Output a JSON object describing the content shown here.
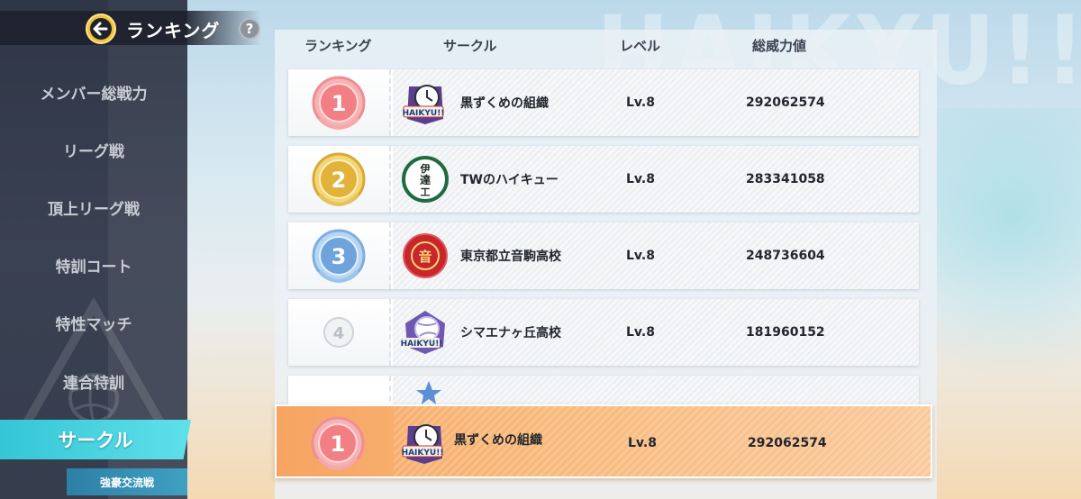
{
  "header": {
    "title": "ランキング",
    "help_label": "?"
  },
  "background": {
    "watermark": "HAIKYU!!"
  },
  "sidebar": {
    "items": [
      {
        "label": "メンバー総戦力"
      },
      {
        "label": "リーグ戦"
      },
      {
        "label": "頂上リーグ戦"
      },
      {
        "label": "特訓コート"
      },
      {
        "label": "特性マッチ"
      },
      {
        "label": "連合特訓"
      }
    ],
    "active": {
      "label": "サークル"
    },
    "sub": {
      "label": "強豪交流戦"
    }
  },
  "table": {
    "columns": [
      "ランキング",
      "サークル",
      "レベル",
      "総威力値"
    ],
    "rows": [
      {
        "rank": "1",
        "name": "黒ずくめの組織",
        "level": "Lv.8",
        "power": "292062574",
        "medal": "pink",
        "emblem": "haikyu-clock"
      },
      {
        "rank": "2",
        "name": "TWのハイキュー",
        "level": "Lv.8",
        "power": "283341058",
        "medal": "gold",
        "emblem": "date-kogyo"
      },
      {
        "rank": "3",
        "name": "東京都立音駒高校",
        "level": "Lv.8",
        "power": "248736604",
        "medal": "blue",
        "emblem": "nekoma"
      },
      {
        "rank": "4",
        "name": "シマエナヶ丘高校",
        "level": "Lv.8",
        "power": "181960152",
        "medal": "plain",
        "emblem": "haikyu-ball"
      }
    ],
    "self_row": {
      "rank": "1",
      "name": "黒ずくめの組織",
      "level": "Lv.8",
      "power": "292062574",
      "emblem_text": "HAIKYU!!"
    }
  },
  "emblem_text": {
    "haikyu": "HAIKYU!!",
    "date_top": "伊",
    "date_mid": "達",
    "date_bot": "工",
    "nekoma": "音"
  },
  "colors": {
    "accent_teal": "#35c6d6",
    "self_orange": "#f7a462",
    "medal_pink": "#f08a8c",
    "medal_gold": "#e8b93a",
    "medal_blue": "#79aee0"
  }
}
